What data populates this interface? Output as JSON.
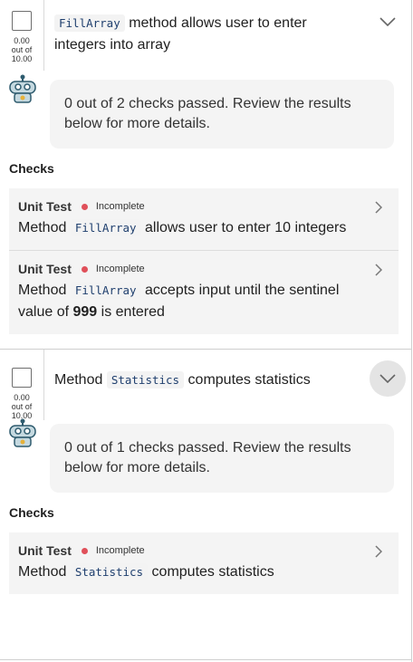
{
  "criteria": [
    {
      "title_code": "FillArray",
      "title_text": "method allows user to enter integers into array",
      "score": "0.00",
      "score_of": "out of",
      "score_max": "10.00",
      "summary": "0 out of 2 checks passed. Review the results below for more details.",
      "checks_label": "Checks",
      "checks": [
        {
          "type": "Unit Test",
          "status": "Incomplete",
          "desc_pre": "Method",
          "desc_code": "FillArray",
          "desc_post": "allows user to enter 10 integers"
        },
        {
          "type": "Unit Test",
          "status": "Incomplete",
          "desc_pre": "Method",
          "desc_code": "FillArray",
          "desc_post": "accepts input until the sentinel value of",
          "desc_bold": "999",
          "desc_tail": "is entered"
        }
      ]
    },
    {
      "title_pre": "Method",
      "title_code": "Statistics",
      "title_text": "computes statistics",
      "score": "0.00",
      "score_of": "out of",
      "score_max": "10.00",
      "summary": "0 out of 1 checks passed. Review the results below for more details.",
      "checks_label": "Checks",
      "checks": [
        {
          "type": "Unit Test",
          "status": "Incomplete",
          "desc_pre": "Method",
          "desc_code": "Statistics",
          "desc_post": "computes statistics"
        }
      ]
    }
  ],
  "colors": {
    "status_dot": "#e0505a",
    "code_text": "#1f3f6e",
    "card_bg": "#f4f4f4"
  }
}
